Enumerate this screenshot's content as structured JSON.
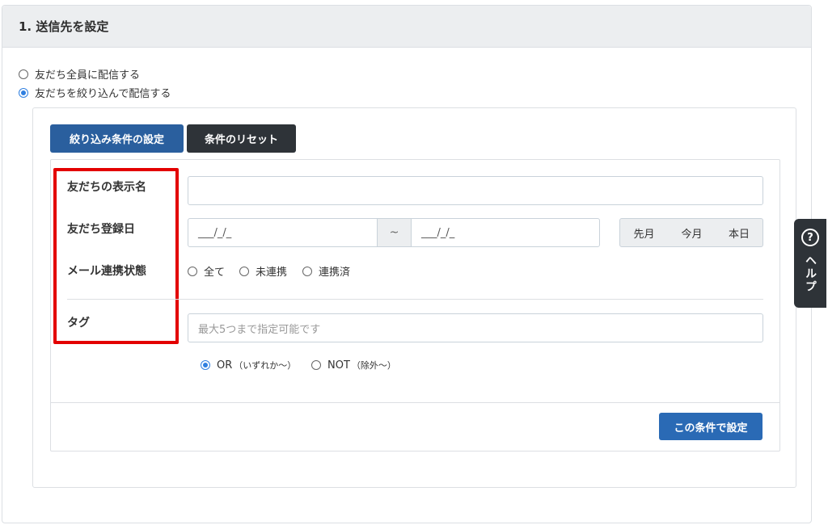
{
  "section": {
    "title": "1. 送信先を設定"
  },
  "send_options": [
    {
      "label": "友だち全員に配信する",
      "checked": false
    },
    {
      "label": "友だちを絞り込んで配信する",
      "checked": true
    }
  ],
  "toolbar": {
    "filter_settings": "絞り込み条件の設定",
    "reset": "条件のリセット"
  },
  "fields": {
    "display_name": {
      "label": "友だちの表示名",
      "value": ""
    },
    "registration_date": {
      "label": "友だち登録日",
      "from": "___/_/_",
      "separator": "~",
      "to": "___/_/_",
      "quick": [
        "先月",
        "今月",
        "本日"
      ]
    },
    "mail_status": {
      "label": "メール連携状態",
      "options": [
        "全て",
        "未連携",
        "連携済"
      ]
    },
    "tag": {
      "label": "タグ",
      "placeholder": "最大5つまで指定可能です",
      "modes": [
        {
          "label": "OR",
          "note": "（いずれか～）",
          "checked": true
        },
        {
          "label": "NOT",
          "note": "（除外～）",
          "checked": false
        }
      ]
    }
  },
  "apply_button": "この条件で設定",
  "help_tab": {
    "icon": "?",
    "label": "ヘルプ"
  },
  "colors": {
    "highlight": "#e30000",
    "primary": "#2a6ab5",
    "dark": "#2e3338"
  }
}
